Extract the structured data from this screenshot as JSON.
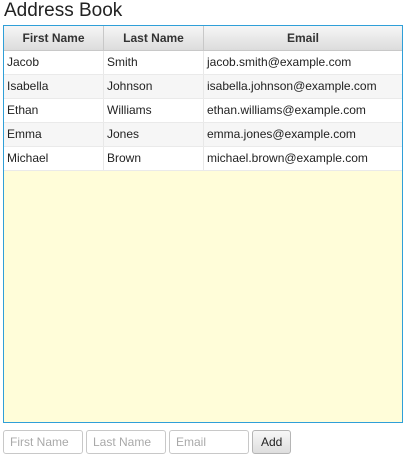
{
  "title": "Address Book",
  "table": {
    "columns": [
      "First Name",
      "Last Name",
      "Email"
    ],
    "rows": [
      [
        "Jacob",
        "Smith",
        "jacob.smith@example.com"
      ],
      [
        "Isabella",
        "Johnson",
        "isabella.johnson@example.com"
      ],
      [
        "Ethan",
        "Williams",
        "ethan.williams@example.com"
      ],
      [
        "Emma",
        "Jones",
        "emma.jones@example.com"
      ],
      [
        "Michael",
        "Brown",
        "michael.brown@example.com"
      ]
    ]
  },
  "form": {
    "first_name_placeholder": "First Name",
    "last_name_placeholder": "Last Name",
    "email_placeholder": "Email",
    "add_label": "Add"
  },
  "colors": {
    "table_border": "#2f9fd8",
    "table_background": "#fffdd9"
  }
}
